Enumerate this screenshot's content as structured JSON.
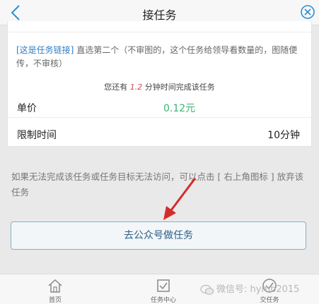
{
  "header": {
    "title": "接任务"
  },
  "task": {
    "link_text": "[这是任务链接]",
    "description": "直选第二个（不审图的，这个任务给领导看数量的，图随便传，不审核）",
    "time_prefix": "您还有",
    "time_value": "1.2",
    "time_suffix": "分钟时间完成该任务",
    "price_label": "单价",
    "price_value": "0.12元",
    "limit_label": "限制时间",
    "limit_value": "10分钟"
  },
  "notice": "如果无法完成该任务或任务目标无法访问，可以点击 [ 右上角图标 ] 放弃该任务",
  "action_button": "去公众号做任务",
  "tabs": [
    {
      "label": "首页",
      "icon": "home-icon"
    },
    {
      "label": "任务中心",
      "icon": "task-center-icon"
    },
    {
      "label": "交任务",
      "icon": "submit-icon"
    }
  ],
  "watermark": "微信号: hymb2015",
  "colors": {
    "link": "#2d7cc7",
    "price": "#3cb371",
    "highlight": "#d54a4a",
    "arrow": "#d62b2b",
    "button_border": "#7fb2c9"
  }
}
